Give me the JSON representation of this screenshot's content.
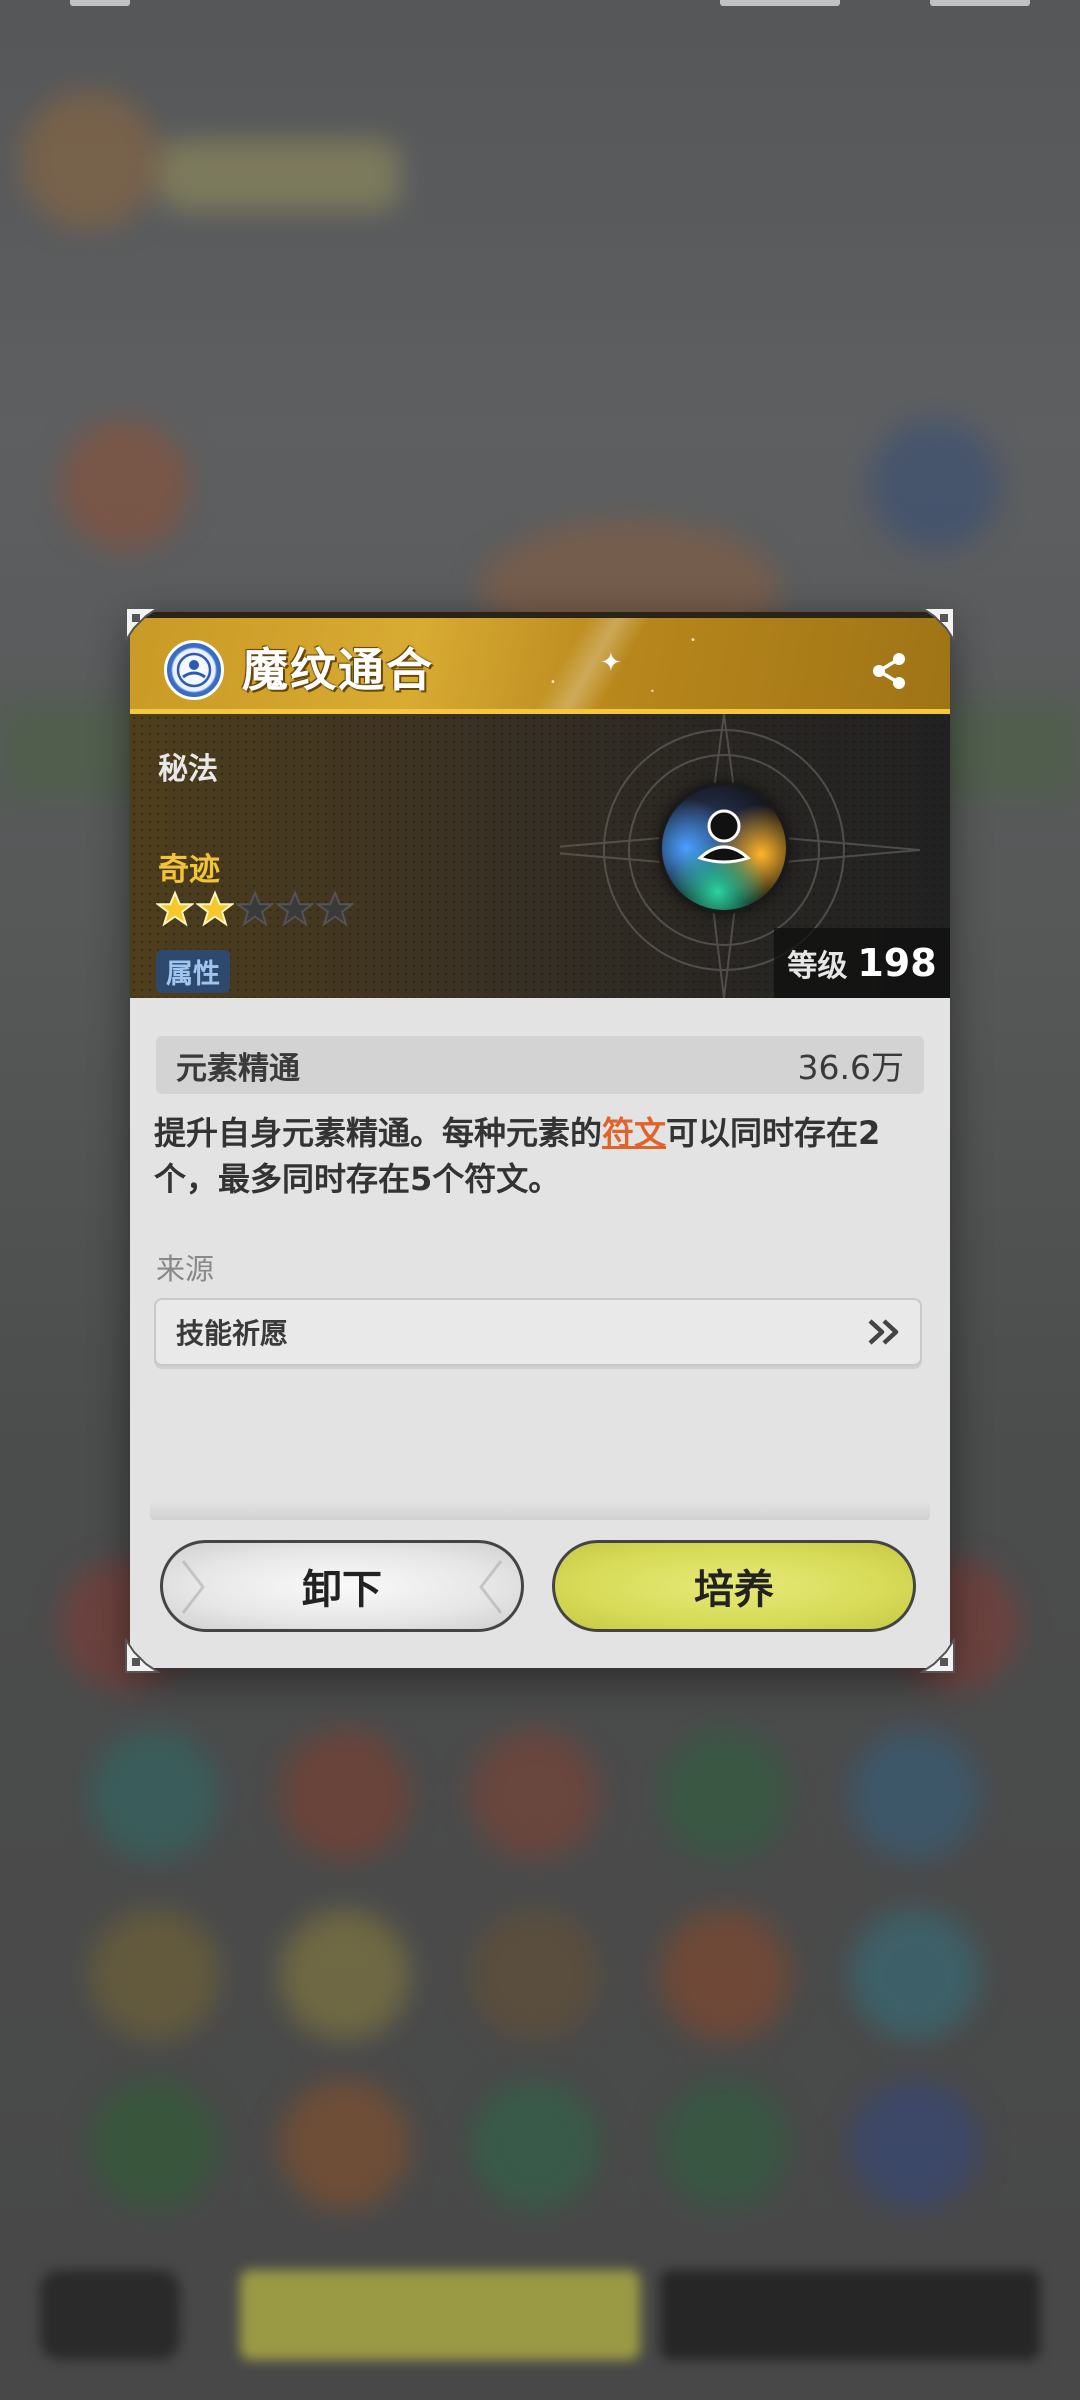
{
  "dialog": {
    "title": "魔纹通合",
    "type": "秘法",
    "rarity": "奇迹",
    "stars_filled": 2,
    "stars_total": 5,
    "attribute_badge": "属性",
    "level_label": "等级",
    "level_value": "198",
    "stat": {
      "name": "元素精通",
      "value": "36.6万"
    },
    "description": {
      "part1": "提升自身元素精通。每种元素的",
      "link": "符文",
      "part2": "可以同时存在2个，最多同时存在5个符文。"
    },
    "source_label": "来源",
    "source_item": "技能祈愿",
    "buttons": {
      "unequip": "卸下",
      "train": "培养"
    }
  },
  "colors": {
    "header_gold": "#d8ab33",
    "rarity_gold": "#f2c437",
    "link_orange": "#e0632b",
    "train_button": "#d7db57",
    "unequip_button": "#e6e6e6"
  },
  "icons": [
    "emblem-icon",
    "share-icon",
    "star-icon",
    "skill-orb-icon",
    "double-chevron-right-icon",
    "corner-ornament-icon"
  ]
}
